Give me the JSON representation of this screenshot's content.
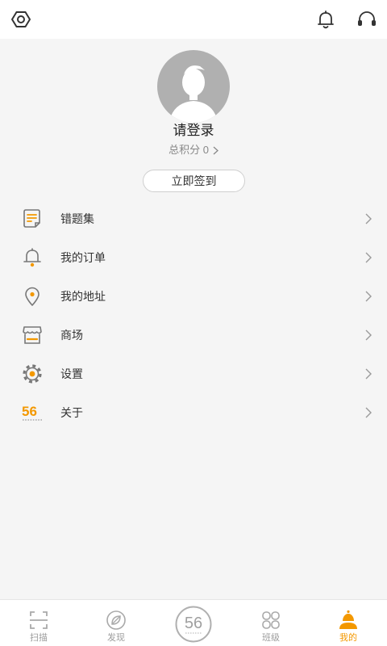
{
  "topbar": {
    "left_icon": "hexagon-settings-icon",
    "right_icons": [
      "notification-bell-icon",
      "customer-service-headset-icon"
    ]
  },
  "profile": {
    "avatar_icon": "default-avatar-icon",
    "login_prompt": "请登录",
    "points_label": "总积分 0",
    "points_chevron_icon": "chevron-right-icon",
    "signin_button": "立即签到"
  },
  "menu": {
    "chevron_icon": "chevron-right-icon",
    "items": [
      {
        "label": "错题集",
        "icon": "notebook-icon"
      },
      {
        "label": "我的订单",
        "icon": "bell-icon"
      },
      {
        "label": "我的地址",
        "icon": "location-pin-icon"
      },
      {
        "label": "商场",
        "icon": "store-icon"
      },
      {
        "label": "设置",
        "icon": "gear-icon"
      },
      {
        "label": "关于",
        "icon": "brand-56-logo-icon",
        "logo_text": "56"
      }
    ]
  },
  "tabbar": {
    "items": [
      {
        "label": "扫描",
        "icon": "scan-icon",
        "active": false
      },
      {
        "label": "发现",
        "icon": "compass-leaf-icon",
        "active": false
      },
      {
        "icon": "brand-56-badge-icon",
        "logo_text": "56",
        "active": false
      },
      {
        "label": "班级",
        "icon": "class-grid-icon",
        "active": false
      },
      {
        "label": "我的",
        "icon": "profile-person-icon",
        "active": true
      }
    ]
  },
  "colors": {
    "accent": "#f39800",
    "text": "#333333",
    "text_secondary": "#888888",
    "background": "#f5f5f5",
    "bar_background": "#ffffff"
  }
}
